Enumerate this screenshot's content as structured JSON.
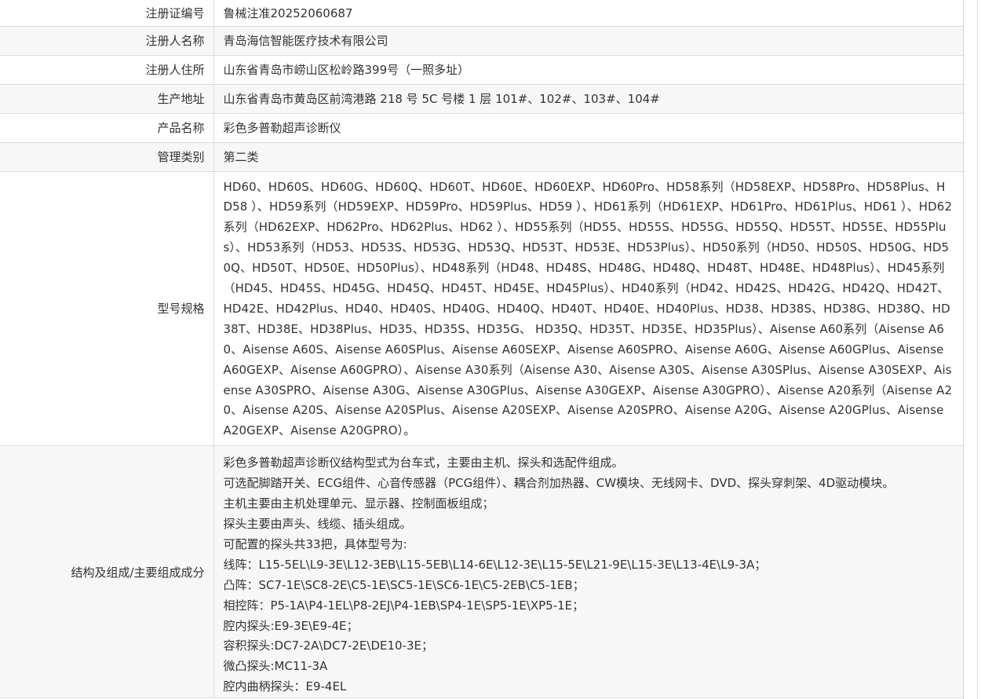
{
  "rows": [
    {
      "label": "注册证编号",
      "value": "鲁械注准20252060687"
    },
    {
      "label": "注册人名称",
      "value": "青岛海信智能医疗技术有限公司"
    },
    {
      "label": "注册人住所",
      "value": "山东省青岛市崂山区松岭路399号（一照多址）"
    },
    {
      "label": "生产地址",
      "value": "山东省青岛市黄岛区前湾港路 218 号 5C 号楼 1 层 101#、102#、103#、104#"
    },
    {
      "label": "产品名称",
      "value": "彩色多普勒超声诊断仪"
    },
    {
      "label": "管理类别",
      "value": "第二类"
    }
  ],
  "model_spec": {
    "label": "型号规格",
    "value": "HD60、HD60S、HD60G、HD60Q、HD60T、HD60E、HD60EXP、HD60Pro、HD58系列（HD58EXP、HD58Pro、HD58Plus、HD58 ）、HD59系列（HD59EXP、HD59Pro、HD59Plus、HD59 ）、HD61系列（HD61EXP、HD61Pro、HD61Plus、HD61 ）、HD62系列（HD62EXP、HD62Pro、HD62Plus、HD62 ）、HD55系列（HD55、HD55S、HD55G、HD55Q、HD55T、HD55E、HD55Plus）、HD53系列（HD53、HD53S、HD53G、HD53Q、HD53T、HD53E、HD53Plus）、HD50系列（HD50、HD50S、HD50G、HD50Q、HD50T、HD50E、HD50Plus）、HD48系列（HD48、HD48S、HD48G、HD48Q、HD48T、HD48E、HD48Plus）、HD45系列（HD45、HD45S、HD45G、HD45Q、HD45T、HD45E、HD45Plus）、HD40系列（HD42、HD42S、HD42G、HD42Q、HD42T、HD42E、HD42Plus、HD40、HD40S、HD40G、HD40Q、HD40T、HD40E、HD40Plus、HD38、HD38S、HD38G、HD38Q、HD38T、HD38E、HD38Plus、HD35、HD35S、HD35G、 HD35Q、HD35T、HD35E、HD35Plus）、Aisense A60系列（Aisense A60、Aisense A60S、Aisense A60SPlus、Aisense A60SEXP、Aisense A60SPRO、Aisense A60G、Aisense A60GPlus、Aisense A60GEXP、Aisense A60GPRO）、Aisense A30系列（Aisense A30、Aisense A30S、Aisense A30SPlus、Aisense A30SEXP、Aisense A30SPRO、Aisense A30G、Aisense A30GPlus、Aisense A30GEXP、Aisense A30GPRO）、Aisense A20系列（Aisense A20、Aisense A20S、Aisense A20SPlus、Aisense A20SEXP、Aisense A20SPRO、Aisense A20G、Aisense A20GPlus、Aisense A20GEXP、Aisense A20GPRO）。"
  },
  "structure": {
    "label": "结构及组成/主要组成成分",
    "lines": [
      "彩色多普勒超声诊断仪结构型式为台车式，主要由主机、探头和选配件组成。",
      "可选配脚踏开关、ECG组件、心音传感器（PCG组件）、耦合剂加热器、CW模块、无线网卡、DVD、探头穿刺架、4D驱动模块。",
      "主机主要由主机处理单元、显示器、控制面板组成；",
      "探头主要由声头、线缆、插头组成。",
      "可配置的探头共33把，具体型号为:",
      "线阵：L15-5EL\\L9-3E\\L12-3EB\\L15-5EB\\L14-6E\\L12-3E\\L15-5E\\L21-9E\\L15-3E\\L13-4E\\L9-3A；",
      "凸阵：SC7-1E\\SC8-2E\\C5-1E\\SC5-1E\\SC6-1E\\C5-2EB\\C5-1EB；",
      "相控阵：P5-1A\\P4-1EL\\P8-2EJ\\P4-1EB\\SP4-1E\\SP5-1E\\XP5-1E；",
      "腔内探头:E9-3E\\E9-4E；",
      "容积探头:DC7-2A\\DC7-2E\\DE10-3E；",
      "微凸探头:MC11-3A",
      "腔内曲柄探头：E9-4EL"
    ]
  }
}
